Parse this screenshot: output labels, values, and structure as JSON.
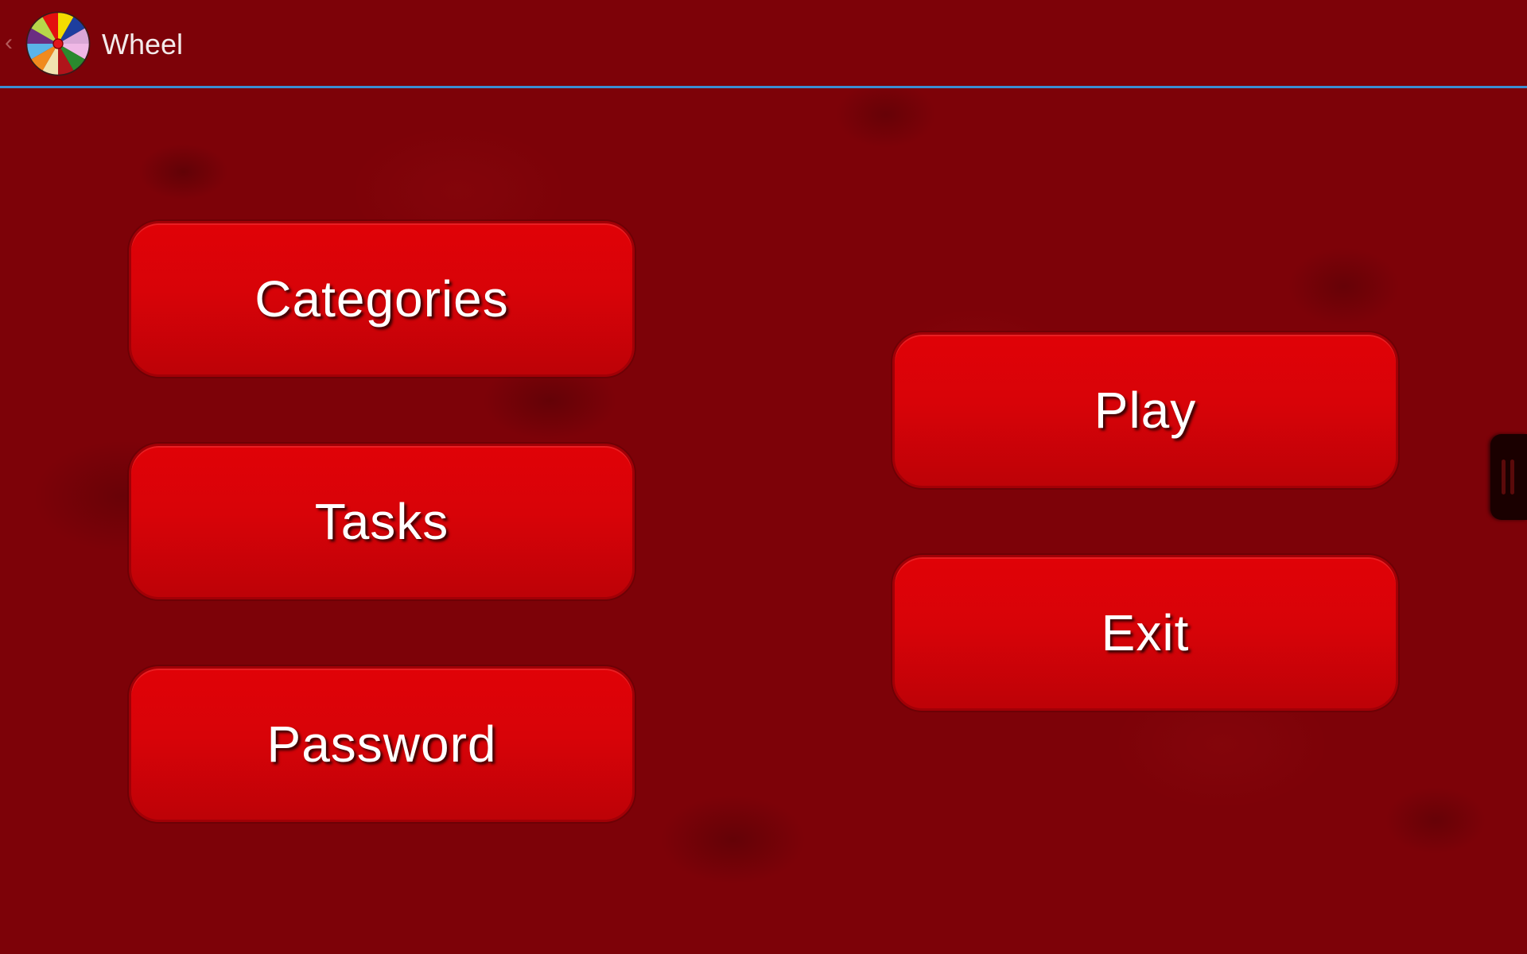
{
  "action_bar": {
    "title": "Wheel",
    "up_caret": "‹",
    "app_icon": "color-wheel-icon",
    "divider_color": "#3b8fd1"
  },
  "menu": {
    "left_column": [
      {
        "label": "Categories"
      },
      {
        "label": "Tasks"
      },
      {
        "label": "Password"
      }
    ],
    "right_column": [
      {
        "label": "Play"
      },
      {
        "label": "Exit"
      }
    ]
  },
  "side_handle": {
    "icon": "drawer-grip-icon"
  },
  "colors": {
    "background": "#7d0208",
    "button_fill": "#d80308",
    "button_border": "#a10006",
    "text": "#ffffff"
  }
}
